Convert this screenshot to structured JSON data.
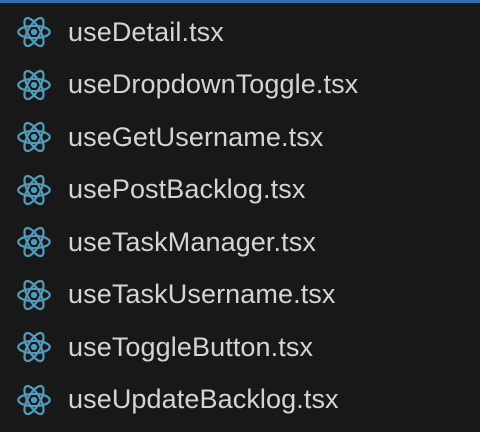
{
  "theme": {
    "background": "#181818",
    "text": "#d4d4d4",
    "icon_color": "#519aba",
    "focus_border": "#2f6fb5"
  },
  "files": [
    {
      "name": "useDetail.tsx",
      "icon": "react-icon"
    },
    {
      "name": "useDropdownToggle.tsx",
      "icon": "react-icon"
    },
    {
      "name": "useGetUsername.tsx",
      "icon": "react-icon"
    },
    {
      "name": "usePostBacklog.tsx",
      "icon": "react-icon"
    },
    {
      "name": "useTaskManager.tsx",
      "icon": "react-icon"
    },
    {
      "name": "useTaskUsername.tsx",
      "icon": "react-icon"
    },
    {
      "name": "useToggleButton.tsx",
      "icon": "react-icon"
    },
    {
      "name": "useUpdateBacklog.tsx",
      "icon": "react-icon"
    }
  ]
}
